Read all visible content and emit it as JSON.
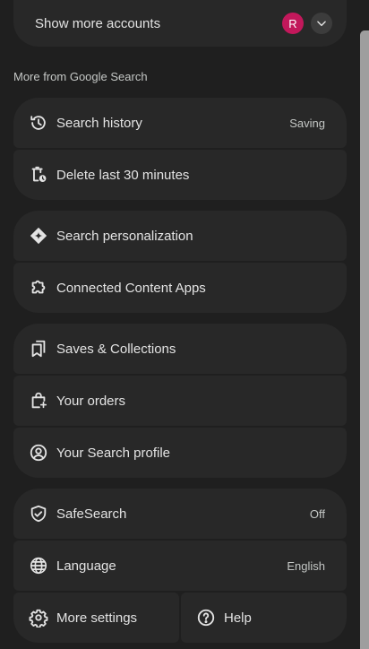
{
  "accounts": {
    "label": "Show more accounts",
    "avatar_initial": "R",
    "avatar_color": "#c2185b"
  },
  "section_heading": "More from Google Search",
  "groups": {
    "history": {
      "search_history": {
        "label": "Search history",
        "status": "Saving",
        "icon": "history-icon"
      },
      "delete_last": {
        "label": "Delete last 30 minutes",
        "icon": "delete-clock-icon"
      }
    },
    "personalization": {
      "personalization": {
        "label": "Search personalization",
        "icon": "sparkle-icon"
      },
      "connected_apps": {
        "label": "Connected Content Apps",
        "icon": "puzzle-icon"
      }
    },
    "saves": {
      "saves": {
        "label": "Saves & Collections",
        "icon": "bookmarks-icon"
      },
      "orders": {
        "label": "Your orders",
        "icon": "shopping-bag-icon"
      },
      "profile": {
        "label": "Your Search profile",
        "icon": "account-circle-icon"
      }
    },
    "settings": {
      "safesearch": {
        "label": "SafeSearch",
        "status": "Off",
        "icon": "shield-icon"
      },
      "language": {
        "label": "Language",
        "status": "English",
        "icon": "globe-icon"
      },
      "more_settings": {
        "label": "More settings",
        "icon": "gear-icon"
      },
      "help": {
        "label": "Help",
        "icon": "help-icon"
      }
    }
  },
  "colors": {
    "background": "#1f1f1f",
    "card": "#282828",
    "text": "#e3e3e3",
    "secondary_text": "#c4c7c5"
  }
}
